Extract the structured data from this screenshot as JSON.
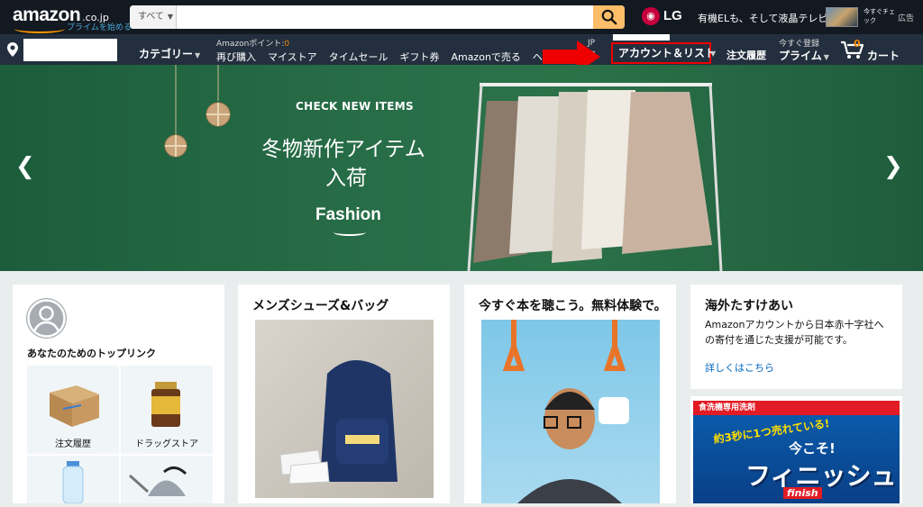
{
  "header": {
    "logo_text": "amazon",
    "logo_domain": ".co.jp",
    "logo_prime": "プライムを始める",
    "search_category": "すべて",
    "search_placeholder": "",
    "ad_brand": "LG",
    "ad_tagline": "有機ELも、そして液晶テレビも。",
    "ad_check": "今すぐチェック",
    "ad_label": "広告"
  },
  "nav": {
    "category": "カテゴリー",
    "points_label": "Amazonポイント:",
    "points_value": "0",
    "links": [
      "再び購入",
      "マイストア",
      "タイムセール",
      "ギフト券",
      "Amazonで売る",
      "ヘルプ"
    ],
    "lang": "JP",
    "account": "アカウント＆リスト",
    "orders": "注文履歴",
    "prime_small": "今すぐ登録",
    "prime_big": "プライム",
    "cart_count": "0",
    "cart": "カート"
  },
  "hero": {
    "kicker": "CHECK NEW ITEMS",
    "title_line1": "冬物新作アイテム",
    "title_line2": "入荷",
    "brand": "Fashion"
  },
  "cards": {
    "toplinks_title": "あなたのためのトップリンク",
    "tiles": [
      "注文履歴",
      "ドラッグストア"
    ],
    "mens_title": "メンズシューズ&バッグ",
    "book_title": "今すぐ本を聴こう。無料体験で。",
    "aid_title": "海外たすけあい",
    "aid_desc": "Amazonアカウントから日本赤十字社への寄付を通じた支援が可能です。",
    "aid_link": "詳しくはこちら",
    "finish_top": "食洗機専用洗剤",
    "finish_mid": "約3秒に1つ売れている!",
    "finish_now": "今こそ!",
    "finish_brand": "フィニッシュ",
    "finish_en": "finish"
  }
}
